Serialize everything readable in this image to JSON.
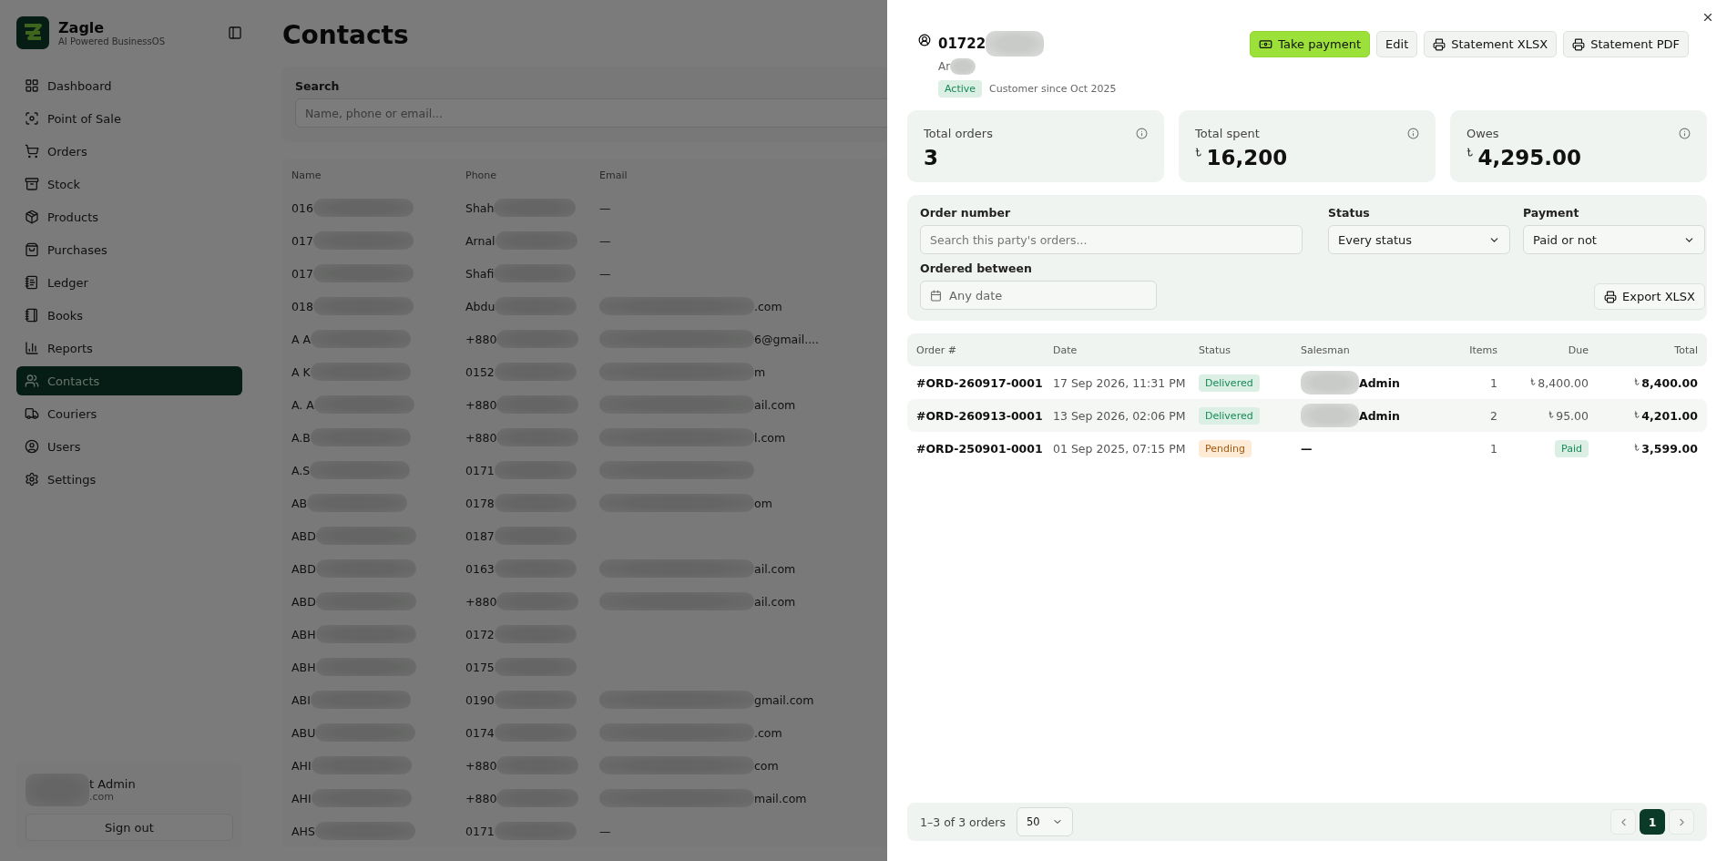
{
  "app": {
    "name": "Zagle",
    "tagline": "AI Powered BusinessOS"
  },
  "nav": [
    {
      "label": "Dashboard",
      "selected": false
    },
    {
      "label": "Point of Sale",
      "selected": false
    },
    {
      "label": "Orders",
      "selected": false
    },
    {
      "label": "Stock",
      "selected": false
    },
    {
      "label": "Products",
      "selected": false
    },
    {
      "label": "Purchases",
      "selected": false
    },
    {
      "label": "Ledger",
      "selected": false
    },
    {
      "label": "Books",
      "selected": false
    },
    {
      "label": "Reports",
      "selected": false
    },
    {
      "label": "Contacts",
      "selected": true
    },
    {
      "label": "Couriers",
      "selected": false
    },
    {
      "label": "Users",
      "selected": false
    },
    {
      "label": "Settings",
      "selected": false
    }
  ],
  "user": {
    "name": "t Admin",
    "email": ".com",
    "sign_out": "Sign out"
  },
  "page": {
    "title": "Contacts",
    "search_label": "Search",
    "search_placeholder": "Name, phone or email..."
  },
  "contacts": {
    "columns": [
      "Name",
      "Phone",
      "Email"
    ],
    "rows": [
      {
        "name": "016",
        "phone": "Shah",
        "email": "—",
        "email_redacted": false
      },
      {
        "name": "017",
        "phone": "Arnal",
        "email": "—",
        "email_redacted": false
      },
      {
        "name": "017",
        "phone": "Shafi",
        "email": "—",
        "email_redacted": false
      },
      {
        "name": "018",
        "phone": "Abdu",
        "email": ".com",
        "email_redacted": true
      },
      {
        "name": "A A",
        "phone": "+880",
        "email": "6@gmail....",
        "email_redacted": true
      },
      {
        "name": "A K",
        "phone": "0152",
        "email": "m",
        "email_redacted": true
      },
      {
        "name": "A. A",
        "phone": "+880",
        "email": "ail.com",
        "email_redacted": true
      },
      {
        "name": "A.B",
        "phone": "+880",
        "email": "l.com",
        "email_redacted": true
      },
      {
        "name": "A.S",
        "phone": "0171",
        "email": "",
        "email_redacted": true
      },
      {
        "name": "AB",
        "phone": "0178",
        "email": "om",
        "email_redacted": true
      },
      {
        "name": "ABD",
        "phone": "0187",
        "email": "",
        "email_redacted": false
      },
      {
        "name": "ABD",
        "phone": "0163",
        "email": "ail.com",
        "email_redacted": true
      },
      {
        "name": "ABD",
        "phone": "+880",
        "email": "ail.com",
        "email_redacted": true
      },
      {
        "name": "ABH",
        "phone": "0172",
        "email": "",
        "email_redacted": false
      },
      {
        "name": "ABH",
        "phone": "0175",
        "email": "",
        "email_redacted": false
      },
      {
        "name": "ABI",
        "phone": "0190",
        "email": "gmail.com",
        "email_redacted": true
      },
      {
        "name": "ABU",
        "phone": "0174",
        "email": ".com",
        "email_redacted": true
      },
      {
        "name": "AHI",
        "phone": "+880",
        "email": "com",
        "email_redacted": true
      },
      {
        "name": "AHI",
        "phone": "+880",
        "email": "mail.com",
        "email_redacted": true
      },
      {
        "name": "AHS",
        "phone": "0171",
        "email": "—",
        "email_redacted": false
      }
    ]
  },
  "drawer": {
    "phone": "01722",
    "name": "Ar",
    "status": "Active",
    "since": "Customer since Oct 2025",
    "actions": [
      {
        "label": "Take payment",
        "kind": "payment"
      },
      {
        "label": "Edit",
        "kind": "plain"
      },
      {
        "label": "Statement XLSX",
        "kind": "print"
      },
      {
        "label": "Statement PDF",
        "kind": "print"
      }
    ],
    "stats": [
      {
        "label": "Total orders",
        "value": "3",
        "kind": "count"
      },
      {
        "label": "Total spent",
        "value": "16,200",
        "kind": "money"
      },
      {
        "label": "Owes",
        "value": "4,295.00",
        "kind": "money"
      }
    ],
    "filters": {
      "order_label": "Order number",
      "order_placeholder": "Search this party's orders...",
      "status_label": "Status",
      "status_value": "Every status",
      "payment_label": "Payment",
      "payment_value": "Paid or not",
      "date_label": "Ordered between",
      "date_placeholder": "Any date",
      "export": "Export XLSX"
    },
    "orders": {
      "columns": [
        "Order #",
        "Date",
        "Status",
        "Salesman",
        "Items",
        "Due",
        "Total"
      ],
      "rows": [
        {
          "number": "#ORD-260917-0001",
          "date": "17 Sep 2026, 11:31 PM",
          "status": {
            "label": "Delivered",
            "kind": "delivered"
          },
          "salesman": "Admin",
          "salesman_redacted": true,
          "items": "1",
          "due": {
            "kind": "amount",
            "text": "8,400.00"
          },
          "total": "8,400.00"
        },
        {
          "number": "#ORD-260913-0001",
          "date": "13 Sep 2026, 02:06 PM",
          "status": {
            "label": "Delivered",
            "kind": "delivered"
          },
          "salesman": "Admin",
          "salesman_redacted": true,
          "items": "2",
          "due": {
            "kind": "amount",
            "text": "95.00"
          },
          "total": "4,201.00"
        },
        {
          "number": "#ORD-250901-0001",
          "date": "01 Sep 2025, 07:15 PM",
          "status": {
            "label": "Pending",
            "kind": "pending"
          },
          "salesman": "—",
          "salesman_redacted": false,
          "items": "1",
          "due": {
            "kind": "paid",
            "text": "Paid"
          },
          "total": "3,599.00"
        }
      ]
    },
    "pager": {
      "summary": "1–3 of 3 orders",
      "page_size": "50",
      "pages": [
        {
          "label": "1",
          "selected": true
        }
      ]
    }
  }
}
